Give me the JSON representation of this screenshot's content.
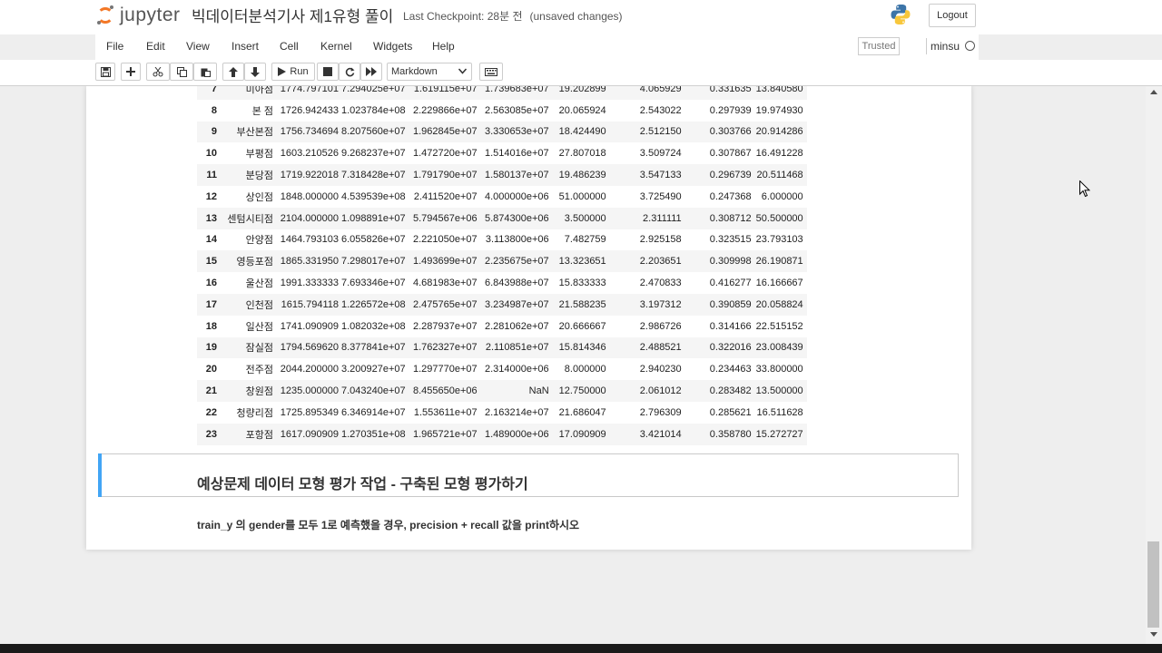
{
  "header": {
    "logo_text": "jupyter",
    "notebook_title": "빅데이터분석기사 제1유형 풀이",
    "checkpoint": "Last Checkpoint: 28분 전",
    "unsaved": "(unsaved changes)",
    "logout_label": "Logout"
  },
  "menu": {
    "items": [
      {
        "label": "File"
      },
      {
        "label": "Edit"
      },
      {
        "label": "View"
      },
      {
        "label": "Insert"
      },
      {
        "label": "Cell"
      },
      {
        "label": "Kernel"
      },
      {
        "label": "Widgets"
      },
      {
        "label": "Help"
      }
    ],
    "trusted_label": "Trusted",
    "kernel_name": "minsu"
  },
  "toolbar": {
    "run_label": "Run",
    "cell_type": "Markdown"
  },
  "table": {
    "rows": [
      {
        "idx": "7",
        "cells": [
          "미아점",
          "1774.797101",
          "7.294025e+07",
          "1.619115e+07",
          "1.739683e+07",
          "19.202899",
          "4.065929",
          "0.331635",
          "13.840580"
        ]
      },
      {
        "idx": "8",
        "cells": [
          "본 점",
          "1726.942433",
          "1.023784e+08",
          "2.229866e+07",
          "2.563085e+07",
          "20.065924",
          "2.543022",
          "0.297939",
          "19.974930"
        ]
      },
      {
        "idx": "9",
        "cells": [
          "부산본점",
          "1756.734694",
          "8.207560e+07",
          "1.962845e+07",
          "3.330653e+07",
          "18.424490",
          "2.512150",
          "0.303766",
          "20.914286"
        ]
      },
      {
        "idx": "10",
        "cells": [
          "부평점",
          "1603.210526",
          "9.268237e+07",
          "1.472720e+07",
          "1.514016e+07",
          "27.807018",
          "3.509724",
          "0.307867",
          "16.491228"
        ]
      },
      {
        "idx": "11",
        "cells": [
          "분당점",
          "1719.922018",
          "7.318428e+07",
          "1.791790e+07",
          "1.580137e+07",
          "19.486239",
          "3.547133",
          "0.296739",
          "20.511468"
        ]
      },
      {
        "idx": "12",
        "cells": [
          "상인점",
          "1848.000000",
          "4.539539e+08",
          "2.411520e+07",
          "4.000000e+06",
          "51.000000",
          "3.725490",
          "0.247368",
          "6.000000"
        ]
      },
      {
        "idx": "13",
        "cells": [
          "센텀시티점",
          "2104.000000",
          "1.098891e+07",
          "5.794567e+06",
          "5.874300e+06",
          "3.500000",
          "2.311111",
          "0.308712",
          "50.500000"
        ]
      },
      {
        "idx": "14",
        "cells": [
          "안양점",
          "1464.793103",
          "6.055826e+07",
          "2.221050e+07",
          "3.113800e+06",
          "7.482759",
          "2.925158",
          "0.323515",
          "23.793103"
        ]
      },
      {
        "idx": "15",
        "cells": [
          "영등포점",
          "1865.331950",
          "7.298017e+07",
          "1.493699e+07",
          "2.235675e+07",
          "13.323651",
          "2.203651",
          "0.309998",
          "26.190871"
        ]
      },
      {
        "idx": "16",
        "cells": [
          "울산점",
          "1991.333333",
          "7.693346e+07",
          "4.681983e+07",
          "6.843988e+07",
          "15.833333",
          "2.470833",
          "0.416277",
          "16.166667"
        ]
      },
      {
        "idx": "17",
        "cells": [
          "인천점",
          "1615.794118",
          "1.226572e+08",
          "2.475765e+07",
          "3.234987e+07",
          "21.588235",
          "3.197312",
          "0.390859",
          "20.058824"
        ]
      },
      {
        "idx": "18",
        "cells": [
          "일산점",
          "1741.090909",
          "1.082032e+08",
          "2.287937e+07",
          "2.281062e+07",
          "20.666667",
          "2.986726",
          "0.314166",
          "22.515152"
        ]
      },
      {
        "idx": "19",
        "cells": [
          "잠실점",
          "1794.569620",
          "8.377841e+07",
          "1.762327e+07",
          "2.110851e+07",
          "15.814346",
          "2.488521",
          "0.322016",
          "23.008439"
        ]
      },
      {
        "idx": "20",
        "cells": [
          "전주점",
          "2044.200000",
          "3.200927e+07",
          "1.297770e+07",
          "2.314000e+06",
          "8.000000",
          "2.940230",
          "0.234463",
          "33.800000"
        ]
      },
      {
        "idx": "21",
        "cells": [
          "창원점",
          "1235.000000",
          "7.043240e+07",
          "8.455650e+06",
          "NaN",
          "12.750000",
          "2.061012",
          "0.283482",
          "13.500000"
        ]
      },
      {
        "idx": "22",
        "cells": [
          "청량리점",
          "1725.895349",
          "6.346914e+07",
          "1.553611e+07",
          "2.163214e+07",
          "21.686047",
          "2.796309",
          "0.285621",
          "16.511628"
        ]
      },
      {
        "idx": "23",
        "cells": [
          "포항점",
          "1617.090909",
          "1.270351e+08",
          "1.965721e+07",
          "1.489000e+06",
          "17.090909",
          "3.421014",
          "0.358780",
          "15.272727"
        ]
      }
    ]
  },
  "markdown": {
    "heading": "예상문제 데이터 모형 평가 작업 - 구축된 모형 평가하기",
    "text": "train_y 의 gender를 모두 1로 예측했을 경우, precision + recall 값을 print하시오"
  },
  "colors": {
    "accent": "#42a5f5",
    "jupyter_orange": "#f37726"
  }
}
